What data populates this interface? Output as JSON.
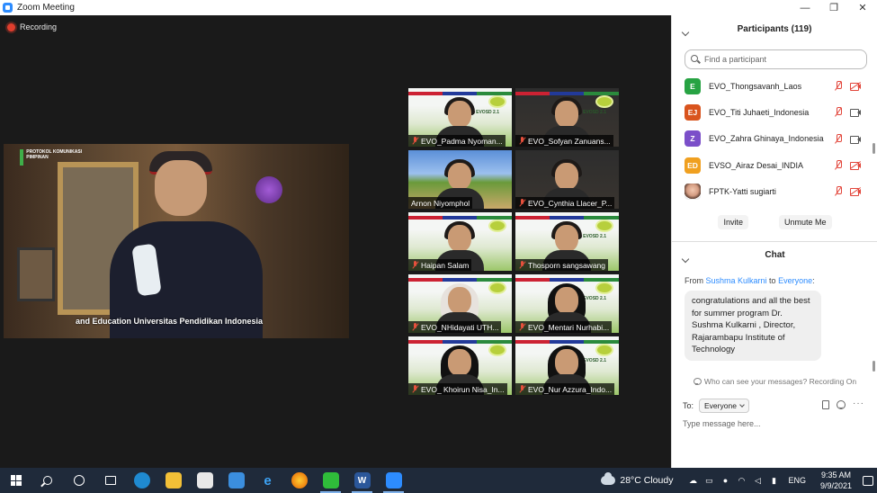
{
  "window": {
    "title": "Zoom Meeting",
    "controls": [
      "—",
      "❐",
      "✕"
    ]
  },
  "meeting": {
    "recording_label": "Recording",
    "speaker": {
      "logo_text": "PROTOKOL KOMUNIKASI PIMPINAN",
      "caption": "and Education Universitas Pendidikan Indonesia"
    },
    "tiles": [
      {
        "name": "EVO_Padma Nyoman..."
      },
      {
        "name": "EVO_Sofyan Zanuans..."
      },
      {
        "name": "Arnon Niyomphol"
      },
      {
        "name": "EVO_Cynthia Llacer_P..."
      },
      {
        "name": "Haipan Salam"
      },
      {
        "name": "Thosporn sangsawang"
      },
      {
        "name": "EVO_NHidayati UTH..."
      },
      {
        "name": "EVO_Mentari Nurhabi..."
      },
      {
        "name": "EVO_ Khoirun Nisa_In..."
      },
      {
        "name": "EVO_Nur Azzura_Indo..."
      }
    ],
    "tile_badge_text": "EVOSD 2.1"
  },
  "participants": {
    "title": "Participants (119)",
    "search_placeholder": "Find a participant",
    "items": [
      {
        "initials": "E",
        "name": "EVO_Thongsavanh_Laos",
        "color": "#27a343",
        "video": "off"
      },
      {
        "initials": "EJ",
        "name": "EVO_Titi Juhaeti_Indonesia",
        "color": "#d9541e",
        "video": "on"
      },
      {
        "initials": "Z",
        "name": "EVO_Zahra Ghinaya_Indonesia",
        "color": "#7b4fc9",
        "video": "on"
      },
      {
        "initials": "ED",
        "name": "EVSO_Airaz Desai_INDIA",
        "color": "#f0a020",
        "video": "off"
      },
      {
        "initials": "",
        "name": "FPTK-Yatti sugiarti",
        "color": "",
        "video": "off"
      }
    ],
    "invite_label": "Invite",
    "unmute_label": "Unmute Me"
  },
  "chat": {
    "title": "Chat",
    "from_prefix": "From ",
    "from_name": "Sushma Kulkarni",
    "to_word": " to ",
    "to_name": "Everyone",
    "colon": ":",
    "message": "congratulations and all the best for summer program Dr. Sushma Kulkarni , Director, Rajarambapu Institute of Technology",
    "visibility_note": "Who can see your messages? Recording On",
    "to_label": "To:",
    "to_value": "Everyone",
    "input_placeholder": "Type message here..."
  },
  "taskbar": {
    "weather": "28°C  Cloudy",
    "language": "ENG",
    "time": "9:35 AM",
    "date": "9/9/2021"
  }
}
